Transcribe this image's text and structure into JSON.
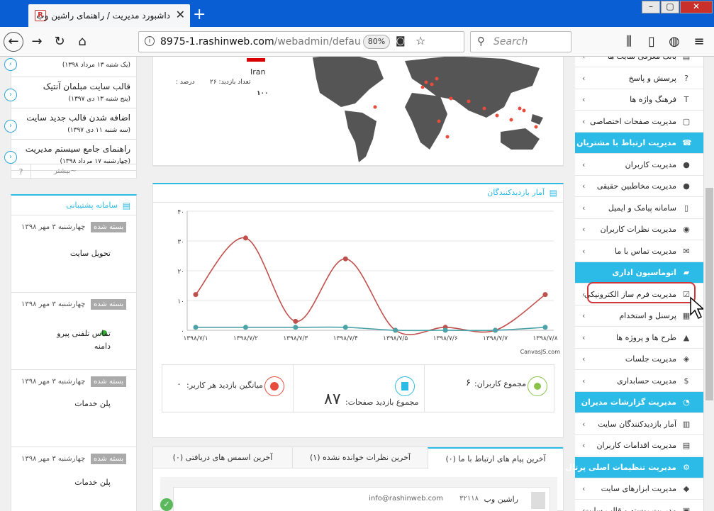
{
  "browser": {
    "tab_title": "داشبورد مدیریت / راهنمای راشین وب",
    "url_host": "8975-1.rashinweb.com",
    "url_path": "/webadmin/defau",
    "zoom": "80%",
    "search_placeholder": "Search",
    "fav_letter": "R"
  },
  "map": {
    "country": "Iran",
    "visits_label": "تعداد بازدید:",
    "visits": "۲۶",
    "percent_label": "درصد :",
    "percent": "۱۰۰"
  },
  "news": [
    {
      "title": "",
      "date": "(یک شنبه ۱۳ مرداد ۱۳۹۸)"
    },
    {
      "title": "قالب سایت مبلمان آنتیک",
      "date": "(پنج شنبه ۱۳ دی ۱۳۹۷)"
    },
    {
      "title": "اضافه شدن قالب جدید سایت",
      "date": "(سه شنبه ۱۱ دی ۱۳۹۷)"
    },
    {
      "title": "راهنمای جامع سیستم مدیریت",
      "date": "(چهارشنبه ۱۷ مرداد ۱۳۹۸)"
    }
  ],
  "more": {
    "label": "بیشتر~",
    "help": "?"
  },
  "support": {
    "title": "سامانه پشتیبانی",
    "rows": [
      {
        "date": "چهارشنبه ۳ مهر ۱۳۹۸",
        "badge": "بسته شده",
        "name": "تحویل سایت"
      },
      {
        "date": "چهارشنبه ۳ مهر ۱۳۹۸",
        "badge": "بسته شده",
        "name": "تماس تلفنی پیرو",
        "name2": "دامنه"
      },
      {
        "date": "چهارشنبه ۳ مهر ۱۳۹۸",
        "badge": "بسته شده",
        "name": "پلن خدمات"
      },
      {
        "date": "چهارشنبه ۳ مهر ۱۳۹۸",
        "badge": "بسته شده",
        "name": "پلن خدمات"
      }
    ]
  },
  "chart_panel": {
    "title": "آمار بازدیدکنندگان",
    "credit": "CanvasJS.com"
  },
  "chart_data": {
    "type": "line",
    "categories": [
      "۱۳۹۸/۷/۱",
      "۱۳۹۸/۷/۲",
      "۱۳۹۸/۷/۳",
      "۱۳۹۸/۷/۴",
      "۱۳۹۸/۷/۵",
      "۱۳۹۸/۷/۶",
      "۱۳۹۸/۷/۷",
      "۱۳۹۸/۷/۸"
    ],
    "series": [
      {
        "values": [
          12,
          31,
          3,
          24,
          0,
          1,
          0,
          12
        ],
        "color": "#c0504d"
      },
      {
        "values": [
          1,
          1,
          1,
          1,
          0,
          0,
          0,
          1
        ],
        "color": "#4aa3a8"
      }
    ],
    "yticks": [
      "۰",
      "۱۰",
      "۲۰",
      "۳۰",
      "۴۰"
    ],
    "ylim": [
      0,
      40
    ]
  },
  "stats": {
    "avg_label": "میانگین بازدید هر کاربر:",
    "avg_value": "۰",
    "pages_label": "مجموع بازدید صفحات:",
    "pages_value": "۸۷",
    "users_label": "مجموع کاربران:",
    "users_value": "۶"
  },
  "bottom_tabs": [
    {
      "label": "آخرین پیام های ارتباط با ما (۰)"
    },
    {
      "label": "آخرین نظرات خوانده نشده (۱)"
    },
    {
      "label": "آخرین اسمس های دریافتی (۰)"
    }
  ],
  "message": {
    "name": "راشین وب",
    "code": "۳۲۱۱۸",
    "email": "info@rashinweb.com"
  },
  "sidebar": [
    {
      "label": "بانک معرفی سایت ها",
      "icon": "▤",
      "head": false
    },
    {
      "label": "پرسش و پاسخ",
      "icon": "?",
      "head": false
    },
    {
      "label": "فرهنگ واژه ها",
      "icon": "T",
      "head": false
    },
    {
      "label": "مدیریت صفحات اختصاصی",
      "icon": "▢",
      "head": false
    },
    {
      "label": "مدیریت ارتباط با مشتریان",
      "icon": "☎",
      "head": true
    },
    {
      "label": "مدیریت کاربران",
      "icon": "●",
      "head": false
    },
    {
      "label": "مدیریت مخاطبین حقیقی",
      "icon": "●",
      "head": false
    },
    {
      "label": "سامانه پیامک و ایمیل",
      "icon": "▯",
      "head": false
    },
    {
      "label": "مدیریت نظرات کاربران",
      "icon": "◉",
      "head": false
    },
    {
      "label": "مدیریت تماس با ما",
      "icon": "✉",
      "head": false
    },
    {
      "label": "اتوماسیون اداری",
      "icon": "▰",
      "head": true
    },
    {
      "label": "مدیریت فرم ساز الکترونیکی",
      "icon": "☑",
      "head": false
    },
    {
      "label": "پرسنل و استخدام",
      "icon": "▦",
      "head": false
    },
    {
      "label": "طرح ها و پروژه ها",
      "icon": "▲",
      "head": false
    },
    {
      "label": "مدیریت جلسات",
      "icon": "◈",
      "head": false
    },
    {
      "label": "مدیریت حسابداری",
      "icon": "$",
      "head": false
    },
    {
      "label": "مدیریت گزارشات مدیران",
      "icon": "◔",
      "head": true
    },
    {
      "label": "آمار بازدیدکنندگان سایت",
      "icon": "▥",
      "head": false
    },
    {
      "label": "مدیریت اقدامات کاربران",
      "icon": "▤",
      "head": false
    },
    {
      "label": "مدیریت تنظیمات اصلی پرتال",
      "icon": "⚙",
      "head": true
    },
    {
      "label": "مدیریت ابزارهای سایت",
      "icon": "◆",
      "head": false
    },
    {
      "label": "مدیریت پوسته و قالب سایت",
      "icon": "▣",
      "head": false
    }
  ],
  "colors": {
    "accent": "#2bbbe6",
    "browser_blue": "#0a5ed4",
    "line_red": "#c0504d",
    "line_teal": "#4aa3a8"
  }
}
